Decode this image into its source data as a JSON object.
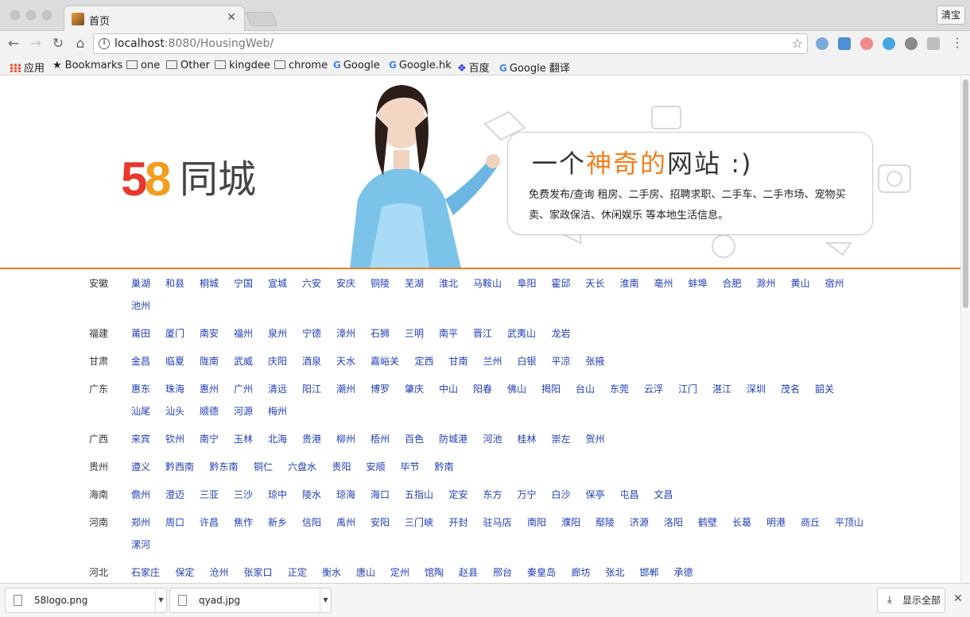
{
  "browser": {
    "tab_title": "首页",
    "url_host": "localhost",
    "url_rest": ":8080/HousingWeb/",
    "profile_label": "清宝",
    "bookmarks": [
      "应用",
      "Bookmarks",
      "one",
      "Other",
      "kingdee",
      "chrome",
      "Google",
      "Google.hk",
      "百度",
      "Google 翻译"
    ]
  },
  "banner": {
    "logo_digits_5": "5",
    "logo_digits_8": "8",
    "brand_name": "同城",
    "headline_prefix": "一个",
    "headline_highlight": "神奇的",
    "headline_suffix": "网站 :)",
    "description": "免费发布/查询 租房、二手房、招聘求职、二手车、二手市场、宠物买卖、家政保洁、休闲娱乐 等本地生活信息。",
    "accent_color": "#f47e1c"
  },
  "provinces": [
    {
      "name": "安徽",
      "cities": [
        "巢湖",
        "和县",
        "桐城",
        "宁国",
        "宣城",
        "六安",
        "安庆",
        "铜陵",
        "芜湖",
        "淮北",
        "马鞍山",
        "阜阳",
        "霍邱",
        "天长",
        "淮南",
        "亳州",
        "蚌埠",
        "合肥",
        "滁州",
        "黄山",
        "宿州",
        "池州"
      ]
    },
    {
      "name": "福建",
      "cities": [
        "莆田",
        "厦门",
        "南安",
        "福州",
        "泉州",
        "宁德",
        "漳州",
        "石狮",
        "三明",
        "南平",
        "晋江",
        "武夷山",
        "龙岩"
      ]
    },
    {
      "name": "甘肃",
      "cities": [
        "金昌",
        "临夏",
        "陇南",
        "武威",
        "庆阳",
        "酒泉",
        "天水",
        "嘉峪关",
        "定西",
        "甘南",
        "兰州",
        "白银",
        "平凉",
        "张掖"
      ]
    },
    {
      "name": "广东",
      "cities": [
        "惠东",
        "珠海",
        "惠州",
        "广州",
        "清远",
        "阳江",
        "潮州",
        "博罗",
        "肇庆",
        "中山",
        "阳春",
        "佛山",
        "揭阳",
        "台山",
        "东莞",
        "云浮",
        "江门",
        "湛江",
        "深圳",
        "茂名",
        "韶关",
        "汕尾",
        "汕头",
        "顺德",
        "河源",
        "梅州"
      ]
    },
    {
      "name": "广西",
      "cities": [
        "来宾",
        "钦州",
        "南宁",
        "玉林",
        "北海",
        "贵港",
        "柳州",
        "梧州",
        "百色",
        "防城港",
        "河池",
        "桂林",
        "崇左",
        "贺州"
      ]
    },
    {
      "name": "贵州",
      "cities": [
        "遵义",
        "黔西南",
        "黔东南",
        "铜仁",
        "六盘水",
        "贵阳",
        "安顺",
        "毕节",
        "黔南"
      ]
    },
    {
      "name": "海南",
      "cities": [
        "儋州",
        "澄迈",
        "三亚",
        "三沙",
        "琼中",
        "陵水",
        "琼海",
        "海口",
        "五指山",
        "定安",
        "东方",
        "万宁",
        "白沙",
        "保亭",
        "屯昌",
        "文昌"
      ]
    },
    {
      "name": "河南",
      "cities": [
        "郑州",
        "周口",
        "许昌",
        "焦作",
        "新乡",
        "信阳",
        "禹州",
        "安阳",
        "三门峡",
        "开封",
        "驻马店",
        "南阳",
        "濮阳",
        "鄢陵",
        "济源",
        "洛阳",
        "鹤壁",
        "长葛",
        "明港",
        "商丘",
        "平顶山",
        "漯河"
      ]
    },
    {
      "name": "河北",
      "cities": [
        "石家庄",
        "保定",
        "沧州",
        "张家口",
        "正定",
        "衡水",
        "唐山",
        "定州",
        "馆陶",
        "赵县",
        "邢台",
        "秦皇岛",
        "廊坊",
        "张北",
        "邯郸",
        "承德"
      ]
    }
  ],
  "downloads": [
    {
      "filename": "58logo.png"
    },
    {
      "filename": "qyad.jpg"
    }
  ],
  "shelf": {
    "show_all": "显示全部"
  }
}
